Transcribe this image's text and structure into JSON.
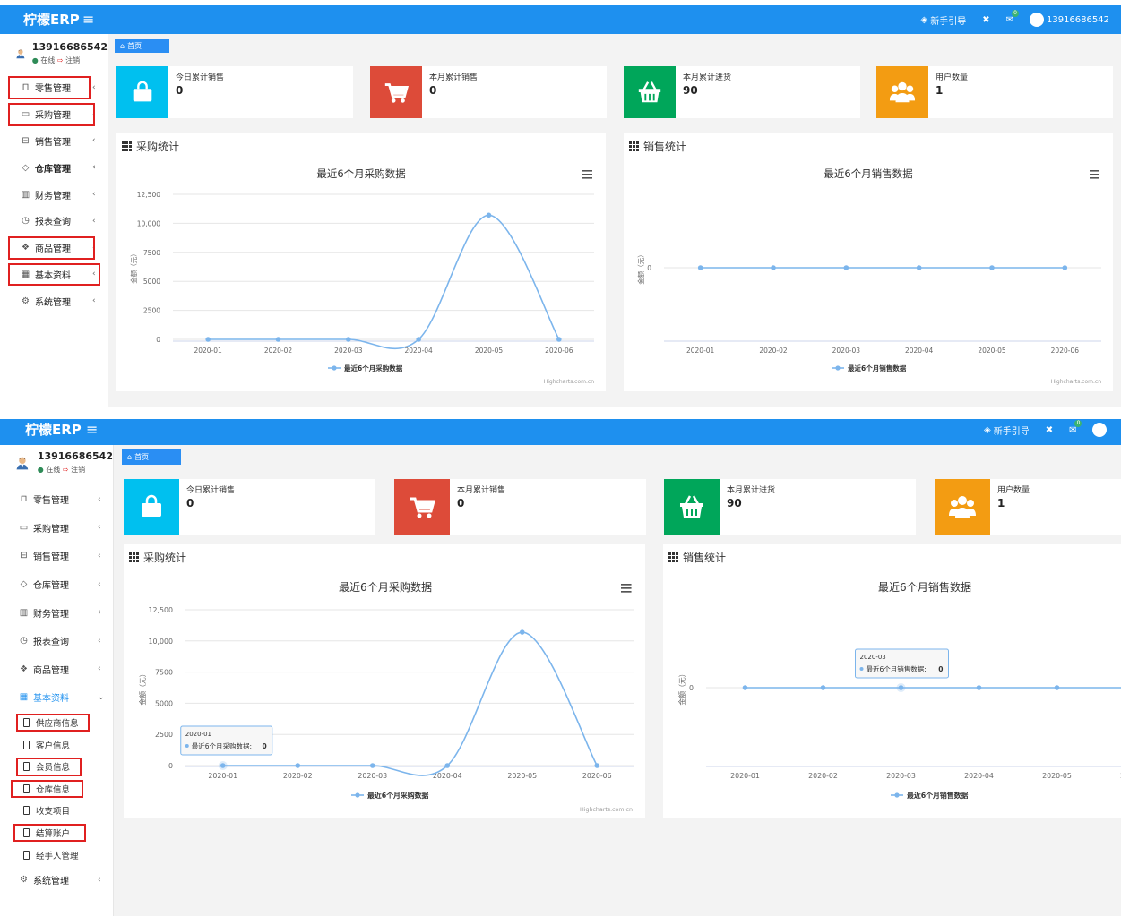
{
  "app": {
    "brand": "柠檬ERP",
    "guide": "新手引导",
    "mail_badge": "0",
    "username": "13916686542"
  },
  "user": {
    "name": "13916686542",
    "status_online": "在线",
    "status_logout": "注销"
  },
  "tab": {
    "label": "首页"
  },
  "menu": [
    {
      "label": "零售管理",
      "icon": "gift-icon"
    },
    {
      "label": "采购管理",
      "icon": "monitor-icon"
    },
    {
      "label": "销售管理",
      "icon": "register-icon"
    },
    {
      "label": "仓库管理",
      "icon": "layers-icon"
    },
    {
      "label": "财务管理",
      "icon": "columns-icon"
    },
    {
      "label": "报表查询",
      "icon": "clock-icon"
    },
    {
      "label": "商品管理",
      "icon": "cubes-icon"
    },
    {
      "label": "基本资料",
      "icon": "apps-icon"
    },
    {
      "label": "系统管理",
      "icon": "gear-icon"
    }
  ],
  "submenu": [
    {
      "label": "供应商信息"
    },
    {
      "label": "客户信息"
    },
    {
      "label": "会员信息"
    },
    {
      "label": "仓库信息"
    },
    {
      "label": "收支项目"
    },
    {
      "label": "结算账户"
    },
    {
      "label": "经手人管理"
    }
  ],
  "stats": [
    {
      "label": "今日累计销售",
      "value": "0",
      "color": "#00c0ef",
      "icon": "shopping-bag-icon"
    },
    {
      "label": "本月累计销售",
      "value": "0",
      "color": "#dd4b39",
      "icon": "cart-icon"
    },
    {
      "label": "本月累计进货",
      "value": "90",
      "color": "#00a65a",
      "icon": "basket-icon"
    },
    {
      "label": "用户数量",
      "value": "1",
      "color": "#f39c12",
      "icon": "users-icon"
    }
  ],
  "panels": {
    "purchase": {
      "title": "采购统计"
    },
    "sales": {
      "title": "销售统计"
    }
  },
  "credits": "Highcharts.com.cn",
  "chart_data": [
    {
      "type": "line",
      "title": "最近6个月采购数据",
      "ylabel": "金额（元）",
      "categories": [
        "2020-01",
        "2020-02",
        "2020-03",
        "2020-04",
        "2020-05",
        "2020-06"
      ],
      "yticks": [
        0,
        2500,
        5000,
        7500,
        10000,
        12500
      ],
      "ytick_labels": [
        "0",
        "2500",
        "5000",
        "7500",
        "10,000",
        "12,500"
      ],
      "ylim": [
        0,
        12500
      ],
      "series": [
        {
          "name": "最近6个月采购数据",
          "values": [
            0,
            0,
            0,
            0,
            10700,
            0
          ]
        }
      ],
      "legend": "bottom-center",
      "color": "#7cb5ec",
      "tooltip": {
        "x": "2020-01",
        "label": "最近6个月采购数据:",
        "value": "0"
      }
    },
    {
      "type": "line",
      "title": "最近6个月销售数据",
      "ylabel": "金额（元）",
      "categories": [
        "2020-01",
        "2020-02",
        "2020-03",
        "2020-04",
        "2020-05",
        "2020-06"
      ],
      "yticks": [
        0
      ],
      "ytick_labels": [
        "0"
      ],
      "series": [
        {
          "name": "最近6个月销售数据",
          "values": [
            0,
            0,
            0,
            0,
            0,
            0
          ]
        }
      ],
      "legend": "bottom-center",
      "color": "#7cb5ec",
      "tooltip": {
        "x": "2020-03",
        "label": "最近6个月销售数据:",
        "value": "0"
      }
    }
  ]
}
